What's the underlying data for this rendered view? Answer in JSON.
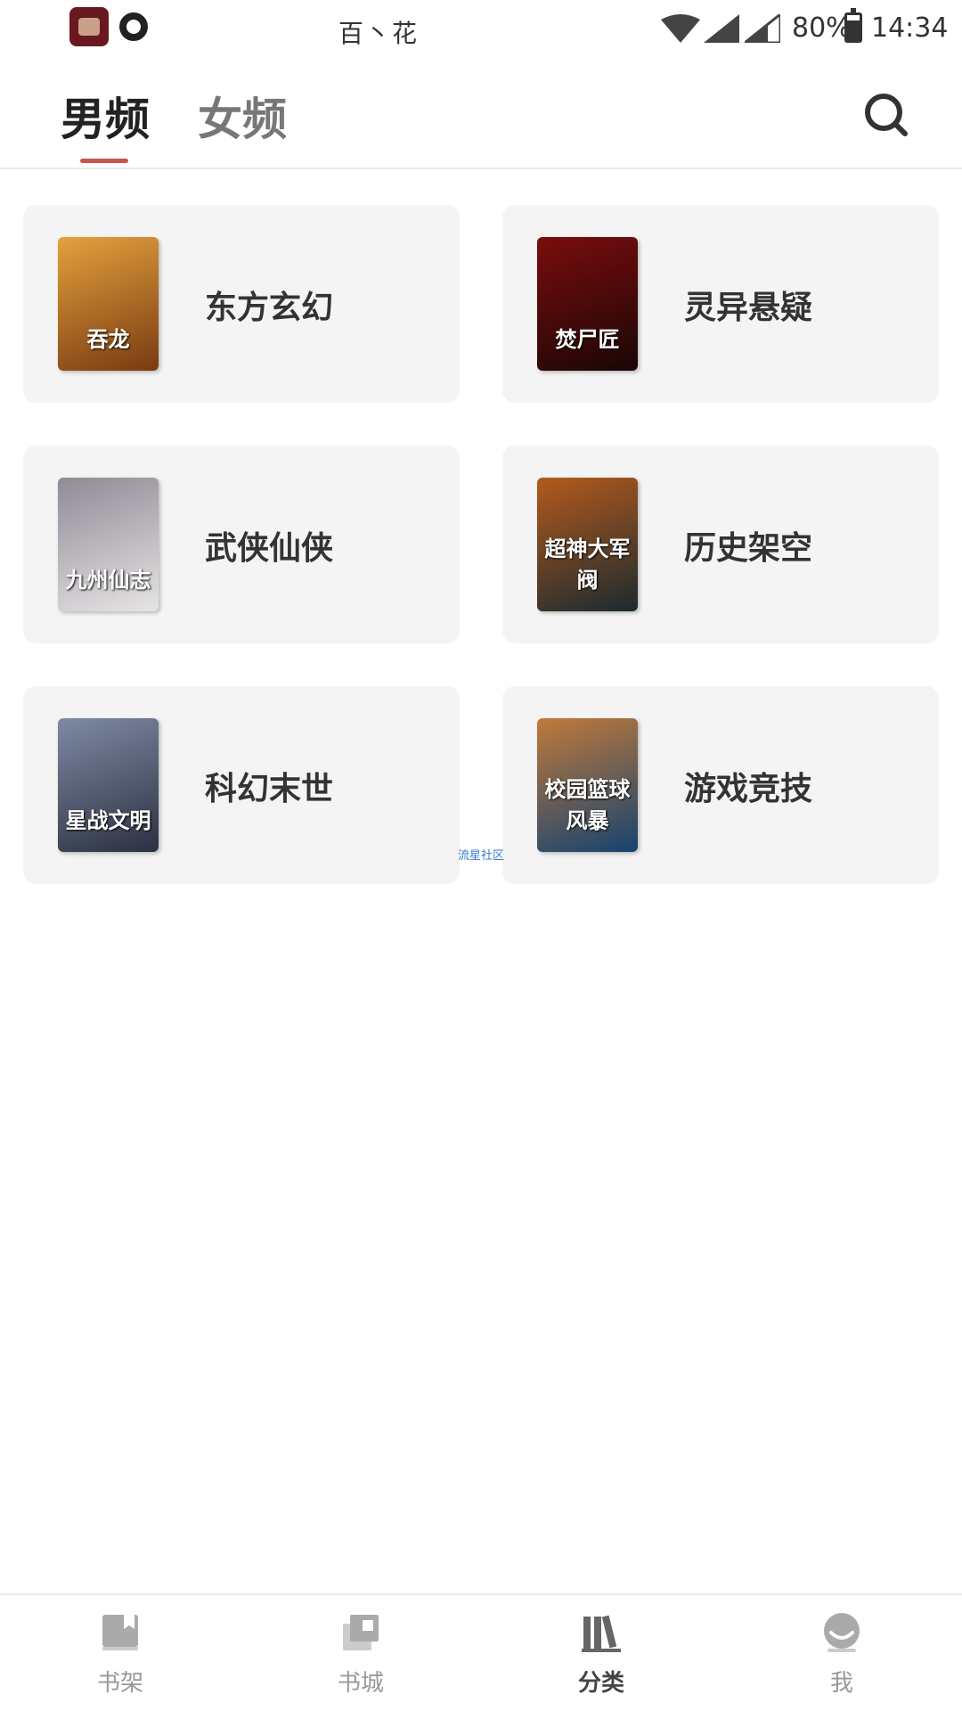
{
  "status_bar": {
    "title": "百丶花",
    "battery": "80%",
    "time": "14:34"
  },
  "tabs": [
    {
      "label": "男频",
      "active": true
    },
    {
      "label": "女频",
      "active": false
    }
  ],
  "categories": [
    {
      "label": "东方玄幻",
      "cover_title": "吞龙",
      "cover_colors": [
        "#7a3a12",
        "#e3a23c"
      ],
      "back_color": "#3b1010"
    },
    {
      "label": "灵异悬疑",
      "cover_title": "焚尸匠",
      "cover_colors": [
        "#1a0606",
        "#7a0d0d"
      ],
      "back_color": "#b97a2a"
    },
    {
      "label": "武侠仙侠",
      "cover_title": "九州仙志",
      "cover_colors": [
        "#e7e4e6",
        "#8f8a94"
      ],
      "back_color": "#4a7ca8"
    },
    {
      "label": "历史架空",
      "cover_title": "超神大军阀",
      "cover_colors": [
        "#1c2a2f",
        "#b45a1c"
      ],
      "back_color": "#3a1a10"
    },
    {
      "label": "科幻末世",
      "cover_title": "星战文明",
      "cover_colors": [
        "#2b3142",
        "#7f8aa3"
      ],
      "back_color": "#1d4a8a"
    },
    {
      "label": "游戏竞技",
      "cover_title": "校园篮球风暴",
      "cover_colors": [
        "#16436f",
        "#c07a3a"
      ],
      "back_color": "#2a2a2a"
    }
  ],
  "watermark": "流星社区",
  "bottom_nav": [
    {
      "label": "书架",
      "icon": "bookshelf-icon",
      "active": false
    },
    {
      "label": "书城",
      "icon": "bookstore-icon",
      "active": false
    },
    {
      "label": "分类",
      "icon": "category-icon",
      "active": true
    },
    {
      "label": "我",
      "icon": "profile-icon",
      "active": false
    }
  ],
  "colors": {
    "accent": "#c9524e",
    "card_bg": "#f4f4f4",
    "inactive_nav": "#999999"
  }
}
